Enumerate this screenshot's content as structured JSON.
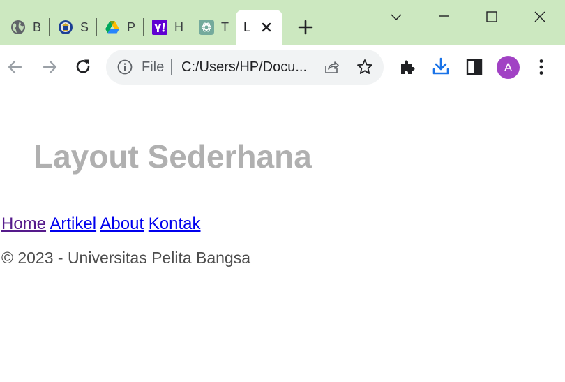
{
  "tabs": [
    {
      "title": "B",
      "icon": "globe-icon"
    },
    {
      "title": "S",
      "icon": "university-crest-icon"
    },
    {
      "title": "P",
      "icon": "google-drive-icon"
    },
    {
      "title": "H",
      "icon": "yahoo-icon"
    },
    {
      "title": "T",
      "icon": "chatgpt-icon"
    }
  ],
  "active_tab": {
    "title": "L"
  },
  "window": {
    "minimize": "minimize-icon",
    "maximize": "maximize-icon",
    "close": "close-icon"
  },
  "omnibox": {
    "chip": "File",
    "url": "C:/Users/HP/Docu..."
  },
  "profile": {
    "initial": "A",
    "color": "#a142c4"
  },
  "colors": {
    "tabstrip": "#cce8c0",
    "link": "#0000ee",
    "visited": "#551a8b",
    "title": "#b0b0b0",
    "download_accent": "#1a73e8"
  },
  "page": {
    "title": "Layout Sederhana",
    "nav": [
      "Home",
      "Artikel",
      "About",
      "Kontak"
    ],
    "footer": "© 2023 - Universitas Pelita Bangsa"
  }
}
